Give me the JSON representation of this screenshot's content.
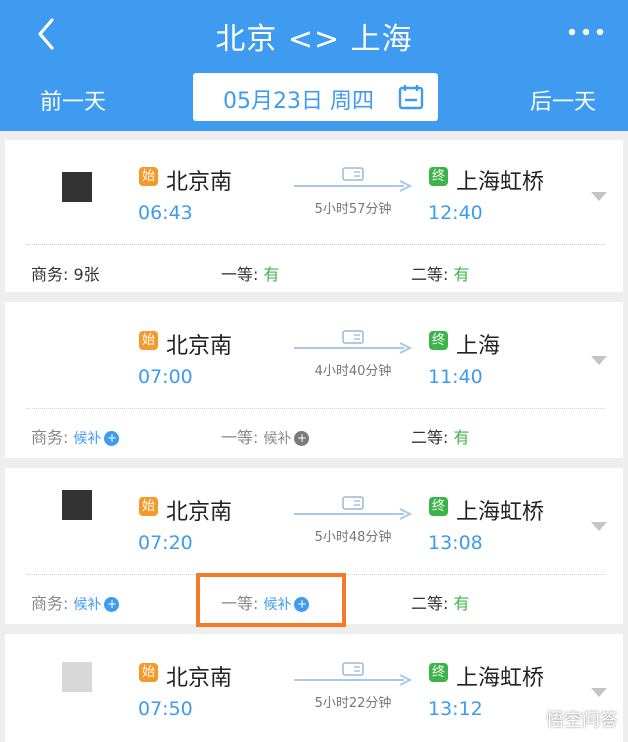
{
  "header": {
    "title": "北京 <> 上海",
    "prev_day": "前一天",
    "next_day": "后一天",
    "date": "05月23日 周四"
  },
  "colors": {
    "brand": "#3f9bf0",
    "available": "#3bb54a",
    "start_badge": "#f59a2a",
    "highlight": "#f47b28"
  },
  "trains": [
    {
      "from": "北京南",
      "from_badge": "始",
      "depart": "06:43",
      "duration": "5小时57分钟",
      "to": "上海虹桥",
      "to_badge": "终",
      "arrive": "12:40",
      "seats": [
        {
          "label": "商务: ",
          "value": "9张",
          "status": "count"
        },
        {
          "label": "一等: ",
          "value": "有",
          "status": "available"
        },
        {
          "label": "二等: ",
          "value": "有",
          "status": "available"
        }
      ]
    },
    {
      "from": "北京南",
      "from_badge": "始",
      "depart": "07:00",
      "duration": "4小时40分钟",
      "to": "上海",
      "to_badge": "终",
      "arrive": "11:40",
      "seats": [
        {
          "label": "商务: ",
          "value": "候补",
          "status": "waitlist"
        },
        {
          "label": "一等: ",
          "value": "候补",
          "status": "waitlist-gray"
        },
        {
          "label": "二等: ",
          "value": "有",
          "status": "available"
        }
      ]
    },
    {
      "from": "北京南",
      "from_badge": "始",
      "depart": "07:20",
      "duration": "5小时48分钟",
      "to": "上海虹桥",
      "to_badge": "终",
      "arrive": "13:08",
      "seats": [
        {
          "label": "商务: ",
          "value": "候补",
          "status": "waitlist"
        },
        {
          "label": "一等: ",
          "value": "候补",
          "status": "waitlist"
        },
        {
          "label": "二等: ",
          "value": "有",
          "status": "available"
        }
      ]
    },
    {
      "from": "北京南",
      "from_badge": "始",
      "depart": "07:50",
      "duration": "5小时22分钟",
      "to": "上海虹桥",
      "to_badge": "终",
      "arrive": "13:12"
    }
  ],
  "icons": {
    "back": "back-chevron-icon",
    "more": "more-dots-icon",
    "calendar": "calendar-icon",
    "expand": "chevron-down-icon",
    "ticket": "id-card-icon"
  },
  "watermark": "悟空问答"
}
